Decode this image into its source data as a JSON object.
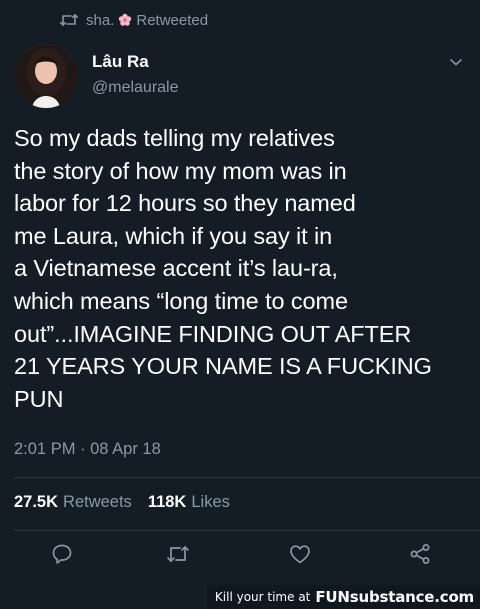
{
  "retweet_banner": {
    "user": "sha.",
    "label": "Retweeted",
    "icon": "retweet-icon",
    "flower_icon": "cherry-blossom-icon"
  },
  "author": {
    "display_name": "Lâu Ra",
    "handle": "@melaurale",
    "avatar": "profile-photo"
  },
  "tweet": {
    "text": "So my dads telling my relatives\nthe story of how my mom was in\nlabor for 12 hours so they named\nme Laura, which if you say it in\na Vietnamese accent it’s lau-ra,\nwhich means “long time to come\nout”...IMAGINE FINDING OUT AFTER\n21 YEARS YOUR NAME IS A FUCKING\nPUN",
    "timestamp": "2:01 PM · 08 Apr 18"
  },
  "stats": {
    "retweets_count": "27.5K",
    "retweets_label": "Retweets",
    "likes_count": "118K",
    "likes_label": "Likes"
  },
  "actions": {
    "reply": "reply-icon",
    "retweet": "retweet-icon",
    "like": "heart-icon",
    "share": "share-icon"
  },
  "watermark": {
    "prefix": "Kill your time at",
    "brand": "FUNsubstance.com"
  },
  "colors": {
    "background": "#141d26",
    "secondary_text": "#8899a6",
    "divider": "#2c3640",
    "primary_text": "#ffffff"
  }
}
